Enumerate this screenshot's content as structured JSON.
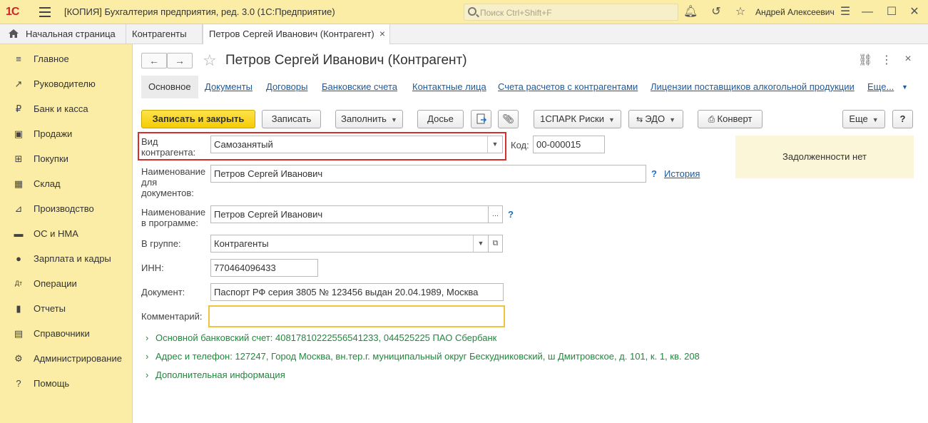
{
  "titlebar": {
    "logo": "1С",
    "title": "[КОПИЯ] Бухгалтерия предприятия, ред. 3.0  (1С:Предприятие)",
    "search_placeholder": "Поиск Ctrl+Shift+F",
    "user": "Андрей Алексеевич",
    "icons": [
      "bell-icon",
      "history-icon",
      "star-icon",
      "settings-icon",
      "minimize-icon",
      "maximize-icon",
      "close-icon"
    ]
  },
  "tabs": {
    "home": "Начальная страница",
    "t2": "Контрагенты",
    "t3": "Петров Сергей Иванович (Контрагент)",
    "close": "×"
  },
  "sidebar": {
    "items": [
      {
        "label": "Главное",
        "icon": "≡"
      },
      {
        "label": "Руководителю",
        "icon": "↗"
      },
      {
        "label": "Банк и касса",
        "icon": "₽"
      },
      {
        "label": "Продажи",
        "icon": "▣"
      },
      {
        "label": "Покупки",
        "icon": "⊞"
      },
      {
        "label": "Склад",
        "icon": "▦"
      },
      {
        "label": "Производство",
        "icon": "⊿"
      },
      {
        "label": "ОС и НМА",
        "icon": "▬"
      },
      {
        "label": "Зарплата и кадры",
        "icon": "●"
      },
      {
        "label": "Операции",
        "icon": "Дт"
      },
      {
        "label": "Отчеты",
        "icon": "▮"
      },
      {
        "label": "Справочники",
        "icon": "▤"
      },
      {
        "label": "Администрирование",
        "icon": "⚙"
      },
      {
        "label": "Помощь",
        "icon": "?"
      }
    ]
  },
  "form": {
    "back": "←",
    "forward": "→",
    "star": "☆",
    "title": "Петров Сергей Иванович (Контрагент)",
    "link_icon": "🔗",
    "more_icon": "⋮",
    "close_icon": "×"
  },
  "subtabs": {
    "items": [
      "Основное",
      "Документы",
      "Договоры",
      "Банковские счета",
      "Контактные лица",
      "Счета расчетов с контрагентами",
      "Лицензии поставщиков алкогольной продукции",
      "Еще..."
    ]
  },
  "toolbar": {
    "save_close": "Записать и закрыть",
    "save": "Записать",
    "fill": "Заполнить",
    "dossier": "Досье",
    "spark": "1СПАРК Риски",
    "edo": "ЭДО",
    "envelope": "Конверт",
    "more": "Еще",
    "help": "?"
  },
  "fields": {
    "kind_label": "Вид\nконтрагента:",
    "kind_value": "Самозанятый",
    "code_label": "Код:",
    "code_value": "00-000015",
    "docname_label": "Наименование\nдля\nдокументов:",
    "docname_value": "Петров Сергей Иванович",
    "history": "История",
    "progname_label": "Наименование\nв программе:",
    "progname_value": "Петров Сергей Иванович",
    "group_label": "В группе:",
    "group_value": "Контрагенты",
    "inn_label": "ИНН:",
    "inn_value": "770464096433",
    "doc_label": "Документ:",
    "doc_value": "Паспорт РФ серия 3805 № 123456 выдан 20.04.1989, Москва",
    "comment_label": "Комментарий:",
    "comment_value": "",
    "help_mark": "?",
    "ellipsis": "..."
  },
  "debt": "Задолженности нет",
  "expanders": [
    "Основной банковский счет: 40817810222556541233, 044525225 ПАО Сбербанк",
    "Адрес и телефон: 127247, Город Москва, вн.тер.г. муниципальный округ Бескудниковский, ш Дмитровское, д. 101, к. 1, кв. 208",
    "Дополнительная информация"
  ]
}
